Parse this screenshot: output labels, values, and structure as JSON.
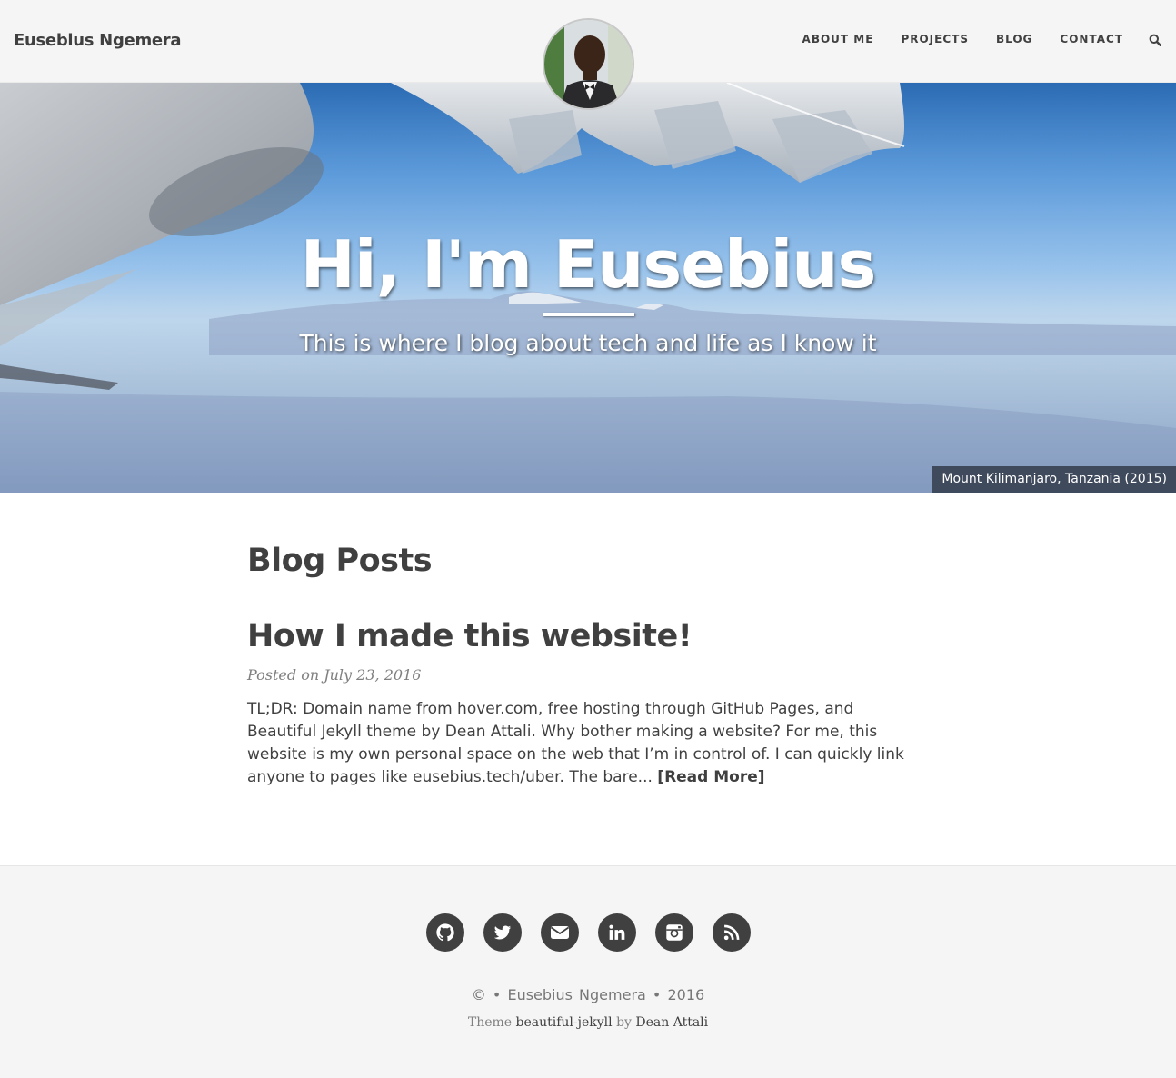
{
  "navbar": {
    "brand": "Euseblus Ngemera",
    "links": [
      {
        "label": "ABOUT ME"
      },
      {
        "label": "PROJECTS"
      },
      {
        "label": "BLOG"
      },
      {
        "label": "CONTACT"
      }
    ],
    "search_icon": "search-icon",
    "avatar_icon": "profile-photo"
  },
  "hero": {
    "title": "Hi, I'm Eusebius",
    "subtitle": "This is where I blog about tech and life as I know it",
    "caption": "Mount Kilimanjaro, Tanzania (2015)"
  },
  "main": {
    "section_title": "Blog Posts",
    "posts": [
      {
        "title": "How I made this website!",
        "meta": "Posted on July 23, 2016",
        "excerpt": "TL;DR: Domain name from hover.com, free hosting through GitHub Pages, and Beautiful Jekyll theme by Dean Attali. Why bother making a website? For me, this website is my own personal space on the web that I’m in control of. I can quickly link anyone to pages like eusebius.tech/uber. The bare...",
        "read_more": "[Read More]"
      }
    ]
  },
  "footer": {
    "social": [
      {
        "icon": "github-icon"
      },
      {
        "icon": "twitter-icon"
      },
      {
        "icon": "email-icon"
      },
      {
        "icon": "linkedin-icon"
      },
      {
        "icon": "instagram-icon"
      },
      {
        "icon": "rss-icon"
      }
    ],
    "copyright_symbol": "©",
    "separator": "•",
    "author": "Eusebius Ngemera",
    "year": "2016",
    "theme_prefix": "Theme",
    "theme_name": "beautiful-jekyll",
    "theme_by": "by",
    "theme_author": "Dean Attali"
  },
  "colors": {
    "text": "#404040",
    "navbar_bg": "#f5f5f5",
    "footer_bg": "#f5f5f5",
    "meta": "#808080"
  }
}
